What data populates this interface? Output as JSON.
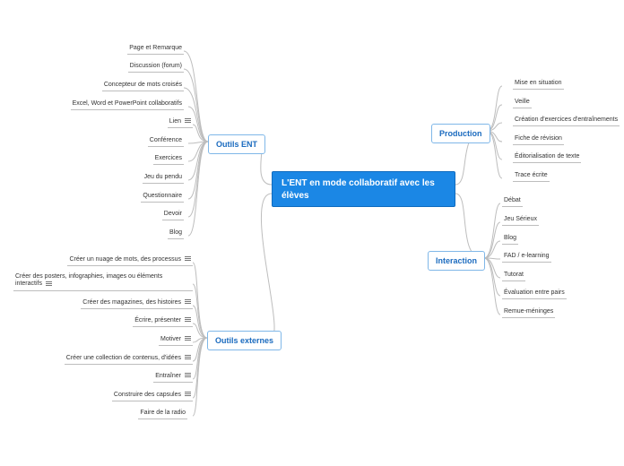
{
  "root": {
    "title": "L'ENT en mode collaboratif avec les élèves"
  },
  "branches": {
    "outilsENT": {
      "label": "Outils ENT",
      "items": [
        "Page et Remarque",
        "Discussion (forum)",
        "Concepteur de mots croisés",
        "Excel, Word et PowerPoint collaboratifs",
        "Lien",
        "Conférence",
        "Exercices",
        "Jeu du pendu",
        "Questionnaire",
        "Devoir",
        "Blog"
      ]
    },
    "outilsExternes": {
      "label": "Outils externes",
      "items": [
        "Créer un nuage de mots, des processus",
        "Créer des posters, infographies, images ou éléments interactifs",
        "Créer des magazines, des histoires",
        "Écrire, présenter",
        "Motiver",
        "Créer une collection de contenus, d'idées",
        "Entraîner",
        "Construire des capsules",
        "Faire de la radio"
      ]
    },
    "production": {
      "label": "Production",
      "items": [
        "Mise en situation",
        "Veille",
        "Création d'exercices d'entraînements",
        "Fiche de révision",
        "Éditorialisation de texte",
        "Trace écrite"
      ]
    },
    "interaction": {
      "label": "Interaction",
      "items": [
        "Débat",
        "Jeu Sérieux",
        "Blog",
        "FAD / e-learning",
        "Tutorat",
        "Évaluation entre pairs",
        "Remue-méninges"
      ]
    }
  },
  "colors": {
    "rootBg": "#1b87e5",
    "branchBorder": "#7fb7e8",
    "branchText": "#1b6bbf",
    "connector": "#bdbdbd"
  }
}
